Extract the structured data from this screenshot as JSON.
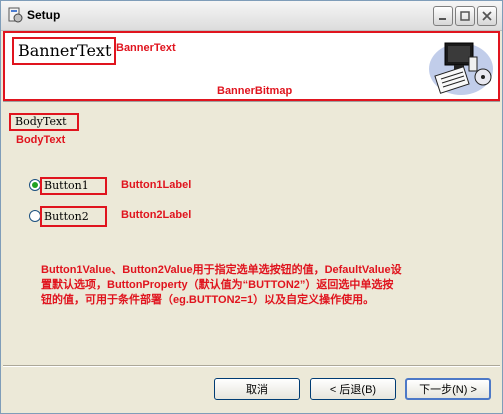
{
  "window": {
    "title": "Setup"
  },
  "banner": {
    "text": "BannerText",
    "text_annotation": "BannerText",
    "bitmap_annotation": "BannerBitmap"
  },
  "body": {
    "text": "BodyText",
    "text_annotation": "BodyText"
  },
  "radios": [
    {
      "label": "Button1",
      "annotation": "Button1Label",
      "selected": true
    },
    {
      "label": "Button2",
      "annotation": "Button2Label",
      "selected": false
    }
  ],
  "description": {
    "line1": "Button1Value、Button2Value用于指定选单选按钮的值，DefaultValue设",
    "line2": "置默认选项，ButtonProperty（默认值为“BUTTON2”）返回选中单选按",
    "line3": "钮的值，可用于条件部署（eg.BUTTON2=1）以及自定义操作使用。"
  },
  "buttons": {
    "cancel": "取消",
    "back": "< 后退(B)",
    "next": "下一步(N) >"
  },
  "colors": {
    "annotation_red": "#e0141e",
    "radio_selected": "#21a121"
  }
}
